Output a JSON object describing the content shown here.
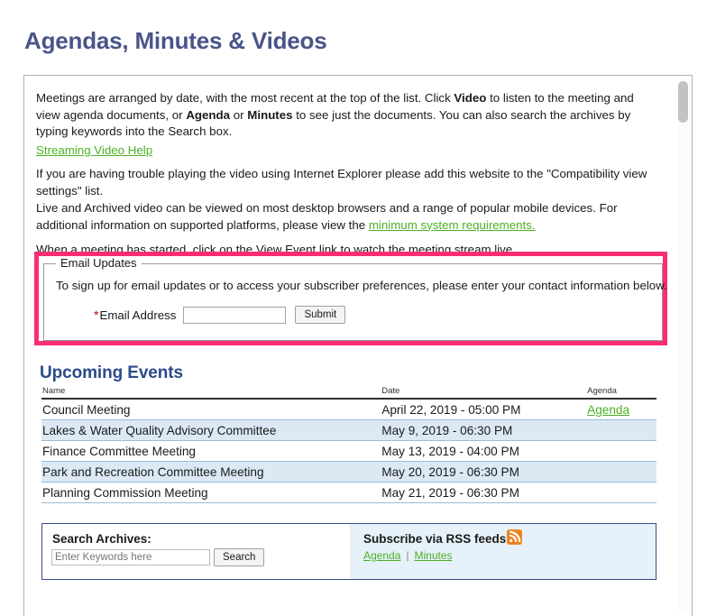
{
  "page": {
    "title": "Agendas, Minutes & Videos"
  },
  "intro": {
    "p1_part1": "Meetings are arranged by date, with the most recent at the top of the list. Click ",
    "p1_bold1": "Video",
    "p1_part2": " to listen to the meeting and view agenda documents, or ",
    "p1_bold2": "Agenda",
    "p1_part3": " or ",
    "p1_bold3": "Minutes",
    "p1_part4": " to see just the documents. You can also search the archives by typing keywords into the Search box.",
    "streaming_help_link": "Streaming Video Help",
    "p2": "If you are having trouble playing the video using Internet Explorer please add this website to the \"Compatibility view settings\" list.",
    "p3_part1": "Live and Archived video can be viewed on most desktop browsers and a range of popular mobile devices. For additional information on supported platforms, please view the ",
    "p3_link": "minimum system requirements.",
    "p4": "When a meeting has started, click on the View Event link to watch the meeting stream live."
  },
  "email_updates": {
    "legend": "Email Updates",
    "description": "To sign up for email updates or to access your subscriber preferences, please enter your contact information below.",
    "required_marker": "*",
    "email_label": "Email Address",
    "email_value": "",
    "email_placeholder": "",
    "submit_label": "Submit",
    "highlight_color": "#fb2d74"
  },
  "upcoming_events": {
    "heading": "Upcoming Events",
    "columns": [
      "Name",
      "Date",
      "Agenda"
    ],
    "rows": [
      {
        "name": "Council Meeting",
        "date": "April 22, 2019 - 05:00 PM",
        "agenda": "Agenda"
      },
      {
        "name": "Lakes & Water Quality Advisory Committee",
        "date": "May  9, 2019 - 06:30 PM",
        "agenda": ""
      },
      {
        "name": "Finance Committee Meeting",
        "date": "May 13, 2019 - 04:00 PM",
        "agenda": ""
      },
      {
        "name": "Park and Recreation Committee Meeting",
        "date": "May 20, 2019 - 06:30 PM",
        "agenda": ""
      },
      {
        "name": "Planning Commission Meeting",
        "date": "May 21, 2019 - 06:30 PM",
        "agenda": ""
      }
    ]
  },
  "search_panel": {
    "search_title": "Search Archives:",
    "search_value": "",
    "search_placeholder": "Enter Keywords here",
    "search_button": "Search",
    "rss_title": "Subscribe via RSS feeds",
    "rss_icon": "rss-icon",
    "rss_agenda_link": "Agenda",
    "rss_separator": "|",
    "rss_minutes_link": "Minutes"
  },
  "colors": {
    "title": "#4a5488",
    "heading": "#2b4a8b",
    "link_green": "#4cb024",
    "highlight_pink": "#fb2d74",
    "row_alt": "#dce9f5",
    "rss_orange": "#f07c1e"
  }
}
